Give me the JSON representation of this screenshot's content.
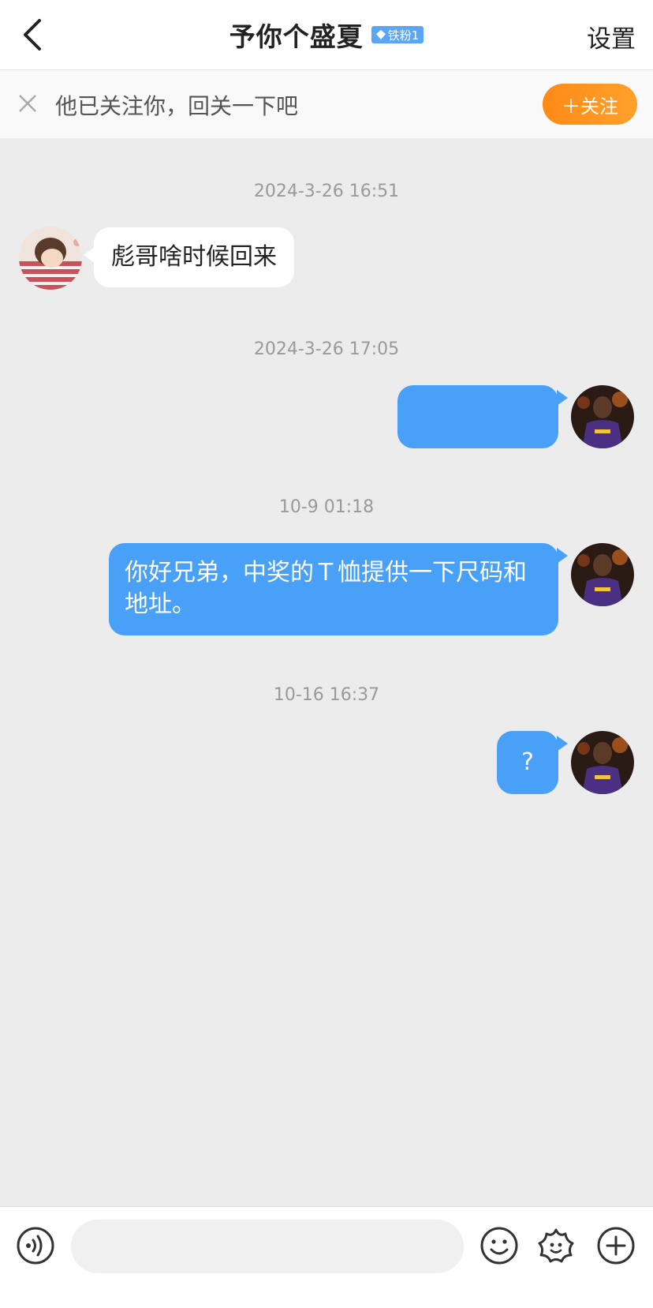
{
  "header": {
    "title": "予你个盛夏",
    "badge": "铁粉1",
    "settings_label": "设置"
  },
  "follow_bar": {
    "text": "他已关注你，回关一下吧",
    "button_label": "＋关注"
  },
  "messages": [
    {
      "time": "2024-3-26 16:51",
      "side": "incoming",
      "text": "彪哥啥时候回来"
    },
    {
      "time": "2024-3-26 17:05",
      "side": "outgoing",
      "text": ""
    },
    {
      "time": "10-9 01:18",
      "side": "outgoing",
      "text": "你好兄弟，中奖的Ｔ恤提供一下尺码和地址。"
    },
    {
      "time": "10-16 16:37",
      "side": "outgoing",
      "text": "?"
    }
  ],
  "colors": {
    "accent_orange": "#ff8a16",
    "outgoing_bubble": "#49a0f7",
    "background": "#ececec"
  },
  "icons": {
    "voice": "voice-icon",
    "emoji": "emoji-icon",
    "sticker": "sticker-icon",
    "more": "plus-icon"
  }
}
